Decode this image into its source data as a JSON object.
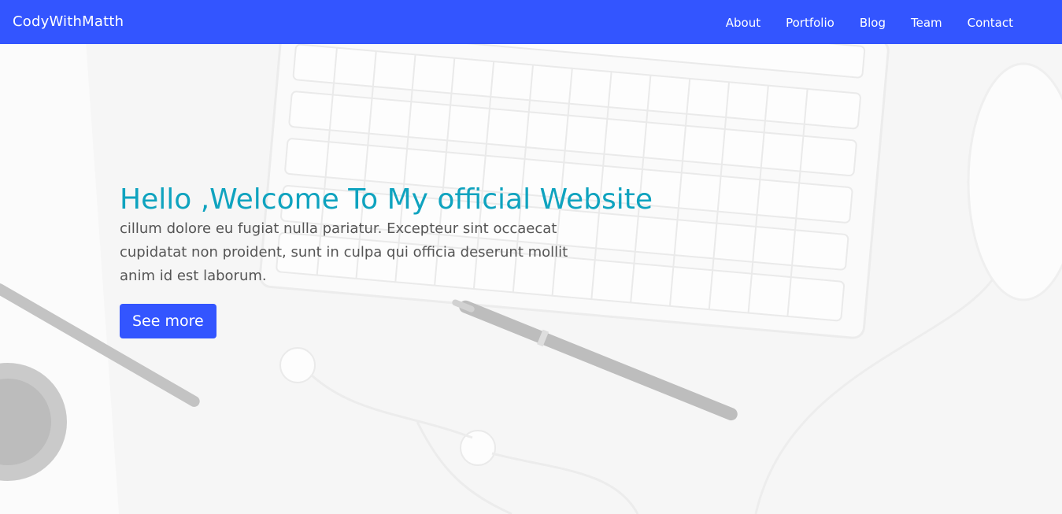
{
  "navbar": {
    "brand": "CodyWithMatth",
    "links": [
      "About",
      "Portfolio",
      "Blog",
      "Team",
      "Contact"
    ],
    "background_color": "#3355ff"
  },
  "hero": {
    "title": "Hello ,Welcome To My official Website",
    "text": "cillum dolore eu fugiat nulla pariatur. Excepteur sint occaecat cupidatat non proident, sunt in culpa qui officia deserunt mollit anim id est laborum.",
    "button_label": "See more",
    "title_color": "#0fa3bf",
    "background_image": "desk-keyboard-pen-earphones-image"
  }
}
